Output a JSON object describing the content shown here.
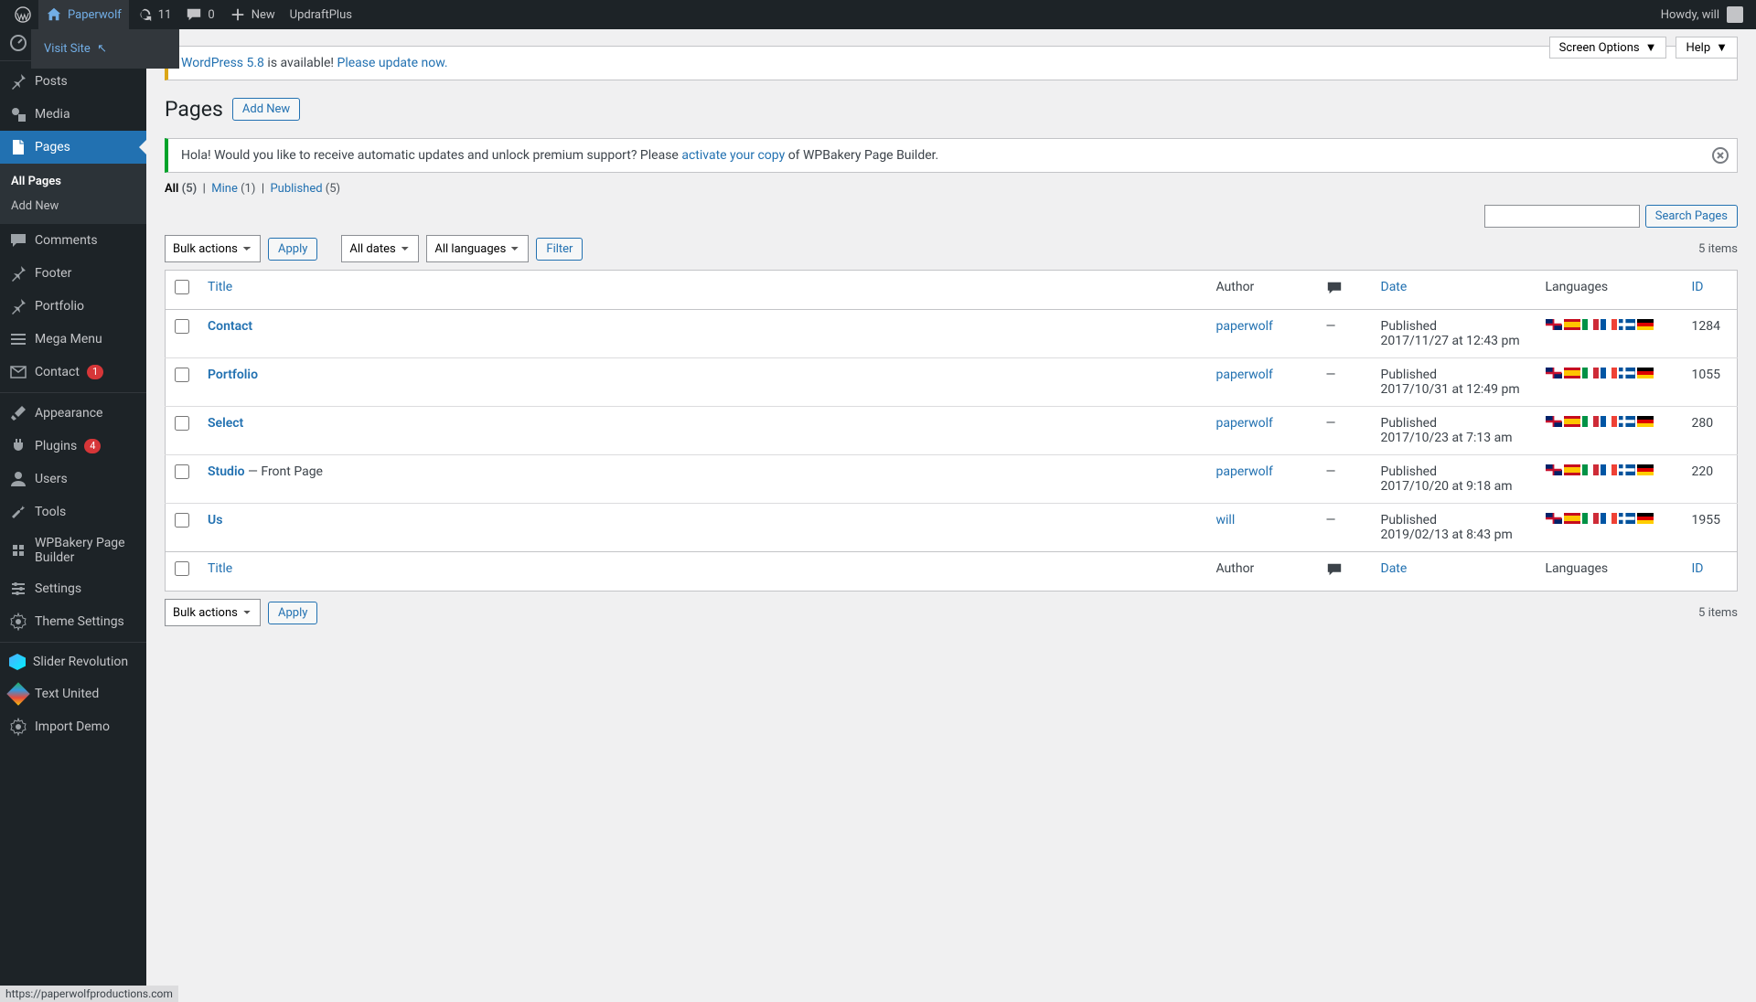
{
  "adminbar": {
    "site_name": "Paperwolf",
    "updates": "11",
    "comments": "0",
    "new": "New",
    "updraft": "UpdraftPlus",
    "howdy": "Howdy, will",
    "visit_site": "Visit Site"
  },
  "sidebar": {
    "dashboard": "Dashboard",
    "posts": "Posts",
    "media": "Media",
    "pages": "Pages",
    "all_pages": "All Pages",
    "add_new": "Add New",
    "comments": "Comments",
    "footer": "Footer",
    "portfolio": "Portfolio",
    "mega_menu": "Mega Menu",
    "contact": "Contact",
    "contact_badge": "1",
    "appearance": "Appearance",
    "plugins": "Plugins",
    "plugins_badge": "4",
    "users": "Users",
    "tools": "Tools",
    "wpbakery": "WPBakery Page Builder",
    "settings": "Settings",
    "theme_settings": "Theme Settings",
    "slider": "Slider Revolution",
    "text_united": "Text United",
    "import_demo": "Import Demo"
  },
  "screen": {
    "options": "Screen Options",
    "help": "Help"
  },
  "notice_update": {
    "link1": "WordPress 5.8",
    "mid": " is available! ",
    "link2": "Please update now."
  },
  "heading": {
    "title": "Pages",
    "add_new": "Add New"
  },
  "notice_wpbakery": {
    "pre": "Hola! Would you like to receive automatic updates and unlock premium support? Please ",
    "link": "activate your copy",
    "post": " of WPBakery Page Builder."
  },
  "filters": {
    "all": "All",
    "all_count": "(5)",
    "mine": "Mine",
    "mine_count": "(1)",
    "published": "Published",
    "published_count": "(5)"
  },
  "search": {
    "btn": "Search Pages"
  },
  "bulk": {
    "label": "Bulk actions",
    "apply": "Apply",
    "dates": "All dates",
    "langs": "All languages",
    "filter": "Filter"
  },
  "count": "5 items",
  "cols": {
    "title": "Title",
    "author": "Author",
    "date": "Date",
    "languages": "Languages",
    "id": "ID"
  },
  "rows": [
    {
      "title": "Contact",
      "suffix": "",
      "author": "paperwolf",
      "comments": "—",
      "status": "Published",
      "date": "2017/11/27 at 12:43 pm",
      "id": "1284"
    },
    {
      "title": "Portfolio",
      "suffix": "",
      "author": "paperwolf",
      "comments": "—",
      "status": "Published",
      "date": "2017/10/31 at 12:49 pm",
      "id": "1055"
    },
    {
      "title": "Select",
      "suffix": "",
      "author": "paperwolf",
      "comments": "—",
      "status": "Published",
      "date": "2017/10/23 at 7:13 am",
      "id": "280"
    },
    {
      "title": "Studio",
      "suffix": " — Front Page",
      "author": "paperwolf",
      "comments": "—",
      "status": "Published",
      "date": "2017/10/20 at 9:18 am",
      "id": "220"
    },
    {
      "title": "Us",
      "suffix": "",
      "author": "will",
      "comments": "—",
      "status": "Published",
      "date": "2019/02/13 at 8:43 pm",
      "id": "1955"
    }
  ],
  "status_url": "https://paperwolfproductions.com"
}
